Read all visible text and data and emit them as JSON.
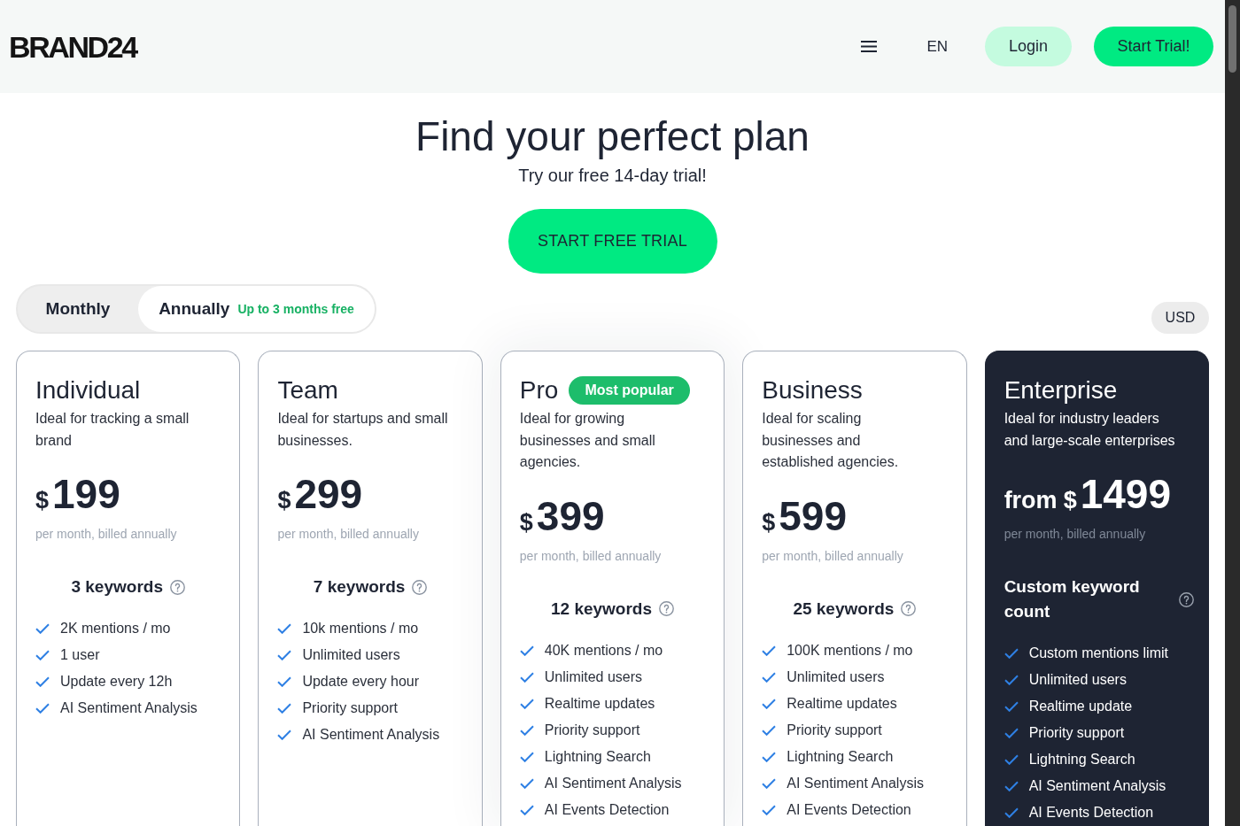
{
  "header": {
    "logo": "BRAND24",
    "language": "EN",
    "login": "Login",
    "cta": "Start Trial!"
  },
  "hero": {
    "title": "Find your perfect plan",
    "subtitle": "Try our free 14-day trial!",
    "cta": "START FREE TRIAL"
  },
  "billing": {
    "options": [
      {
        "label": "Monthly",
        "selected": false
      },
      {
        "label": "Annually",
        "selected": true,
        "note": "Up to 3 months free"
      }
    ],
    "currency": "USD"
  },
  "plans": [
    {
      "kind": "standard",
      "name": "Individual",
      "description": "Ideal for tracking a small brand",
      "currency": "$",
      "price": "199",
      "period": "per month, billed annually",
      "keywords": "3 keywords",
      "features": [
        "2K mentions / mo",
        "1 user",
        "Update every 12h",
        "AI Sentiment Analysis"
      ]
    },
    {
      "kind": "standard",
      "name": "Team",
      "description": "Ideal for startups and small businesses.",
      "currency": "$",
      "price": "299",
      "period": "per month, billed annually",
      "keywords": "7 keywords",
      "features": [
        "10k mentions / mo",
        "Unlimited users",
        "Update every hour",
        "Priority support",
        "AI Sentiment Analysis"
      ]
    },
    {
      "kind": "standard",
      "name": "Pro",
      "badge": "Most popular",
      "description": "Ideal for growing businesses and small agencies.",
      "currency": "$",
      "price": "399",
      "period": "per month, billed annually",
      "keywords": "12 keywords",
      "features": [
        "40K mentions / mo",
        "Unlimited users",
        "Realtime updates",
        "Priority support",
        "Lightning Search",
        "AI Sentiment Analysis",
        "AI Events Detection"
      ]
    },
    {
      "kind": "standard",
      "name": "Business",
      "description": "Ideal for scaling businesses and established agencies.",
      "currency": "$",
      "price": "599",
      "period": "per month, billed annually",
      "keywords": "25 keywords",
      "features": [
        "100K mentions / mo",
        "Unlimited users",
        "Realtime updates",
        "Priority support",
        "Lightning Search",
        "AI Sentiment Analysis",
        "AI Events Detection"
      ]
    },
    {
      "kind": "enterprise",
      "name": "Enterprise",
      "description": "Ideal for industry leaders and large-scale enterprises",
      "prefix": "from",
      "currency": "$",
      "price": "1499",
      "period": "per month, billed annually",
      "keywords": "Custom keyword count",
      "features": [
        "Custom mentions limit",
        "Unlimited users",
        "Realtime update",
        "Priority support",
        "Lightning Search",
        "AI Sentiment Analysis",
        "AI Events Detection"
      ]
    }
  ]
}
